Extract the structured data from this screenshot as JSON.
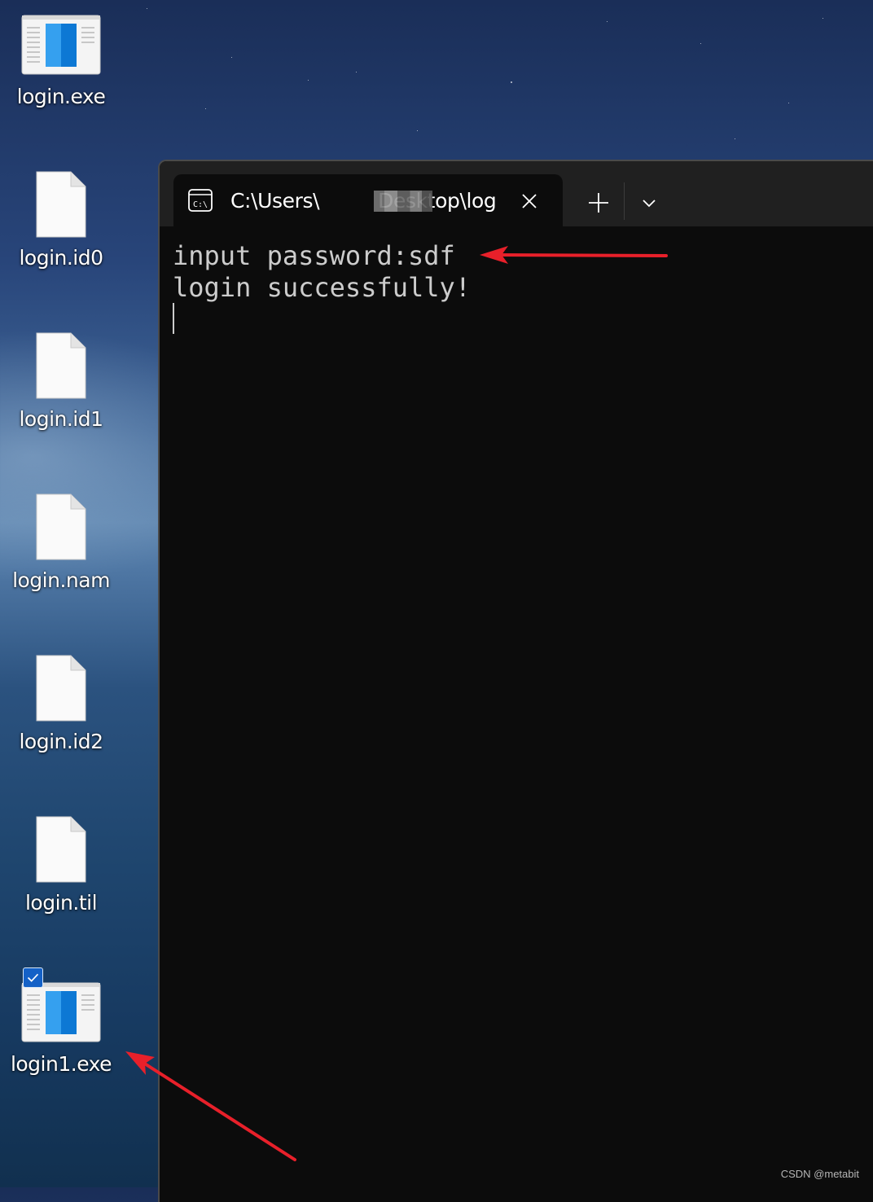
{
  "desktop": {
    "icons": [
      {
        "label": "login.exe",
        "icon": "exe-icon"
      },
      {
        "label": "login.id0",
        "icon": "file-icon"
      },
      {
        "label": "login.id1",
        "icon": "file-icon"
      },
      {
        "label": "login.nam",
        "icon": "file-icon"
      },
      {
        "label": "login.id2",
        "icon": "file-icon"
      },
      {
        "label": "login.til",
        "icon": "file-icon"
      },
      {
        "label": "login1.exe",
        "icon": "exe-icon",
        "selected": true
      }
    ]
  },
  "terminal": {
    "tab_title_prefix": "C:\\Users\\",
    "tab_title_suffix": "Desktop\\log",
    "tab_icon": "cmd-icon",
    "lines": [
      "input password:sdf",
      "login successfully!"
    ]
  },
  "annotations": {
    "arrow_color": "#e8202a"
  },
  "watermark": "CSDN @metabit"
}
